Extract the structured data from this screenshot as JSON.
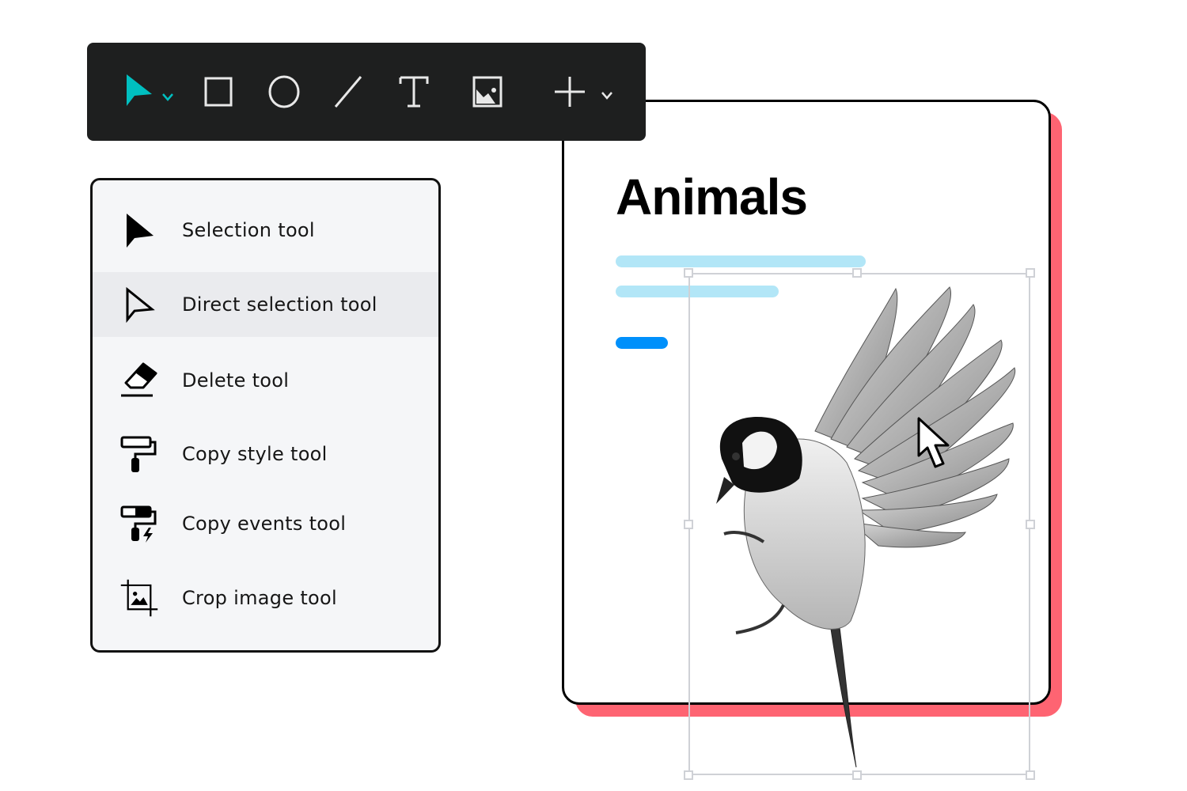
{
  "toolbar": {
    "tools": [
      {
        "name": "selection",
        "icon": "arrow-pointer-icon",
        "has_dropdown": true,
        "active": true
      },
      {
        "name": "rectangle",
        "icon": "rectangle-icon"
      },
      {
        "name": "ellipse",
        "icon": "ellipse-icon"
      },
      {
        "name": "line",
        "icon": "line-icon"
      },
      {
        "name": "text",
        "icon": "text-icon",
        "glyph": "T"
      },
      {
        "name": "image",
        "icon": "image-icon"
      },
      {
        "name": "add",
        "icon": "plus-icon",
        "has_dropdown": true
      }
    ],
    "accent_color": "#00bfc0"
  },
  "menu": {
    "items": [
      {
        "label": "Selection tool",
        "icon": "selection-arrow-icon",
        "active": false
      },
      {
        "label": "Direct selection tool",
        "icon": "direct-selection-arrow-icon",
        "active": true
      },
      {
        "label": "Delete tool",
        "icon": "eraser-icon",
        "active": false
      },
      {
        "label": "Copy style tool",
        "icon": "paint-roller-icon",
        "active": false
      },
      {
        "label": "Copy events tool",
        "icon": "paint-roller-bolt-icon",
        "active": false
      },
      {
        "label": "Crop image tool",
        "icon": "crop-image-icon",
        "active": false
      }
    ]
  },
  "card": {
    "title": "Animals",
    "shadow_color": "#fe6472",
    "text_bar_color": "#b2e6f7",
    "button_bar_color": "#0090fb"
  },
  "canvas": {
    "selected_object": "bird image",
    "selection_color": "#cfd1d6"
  }
}
